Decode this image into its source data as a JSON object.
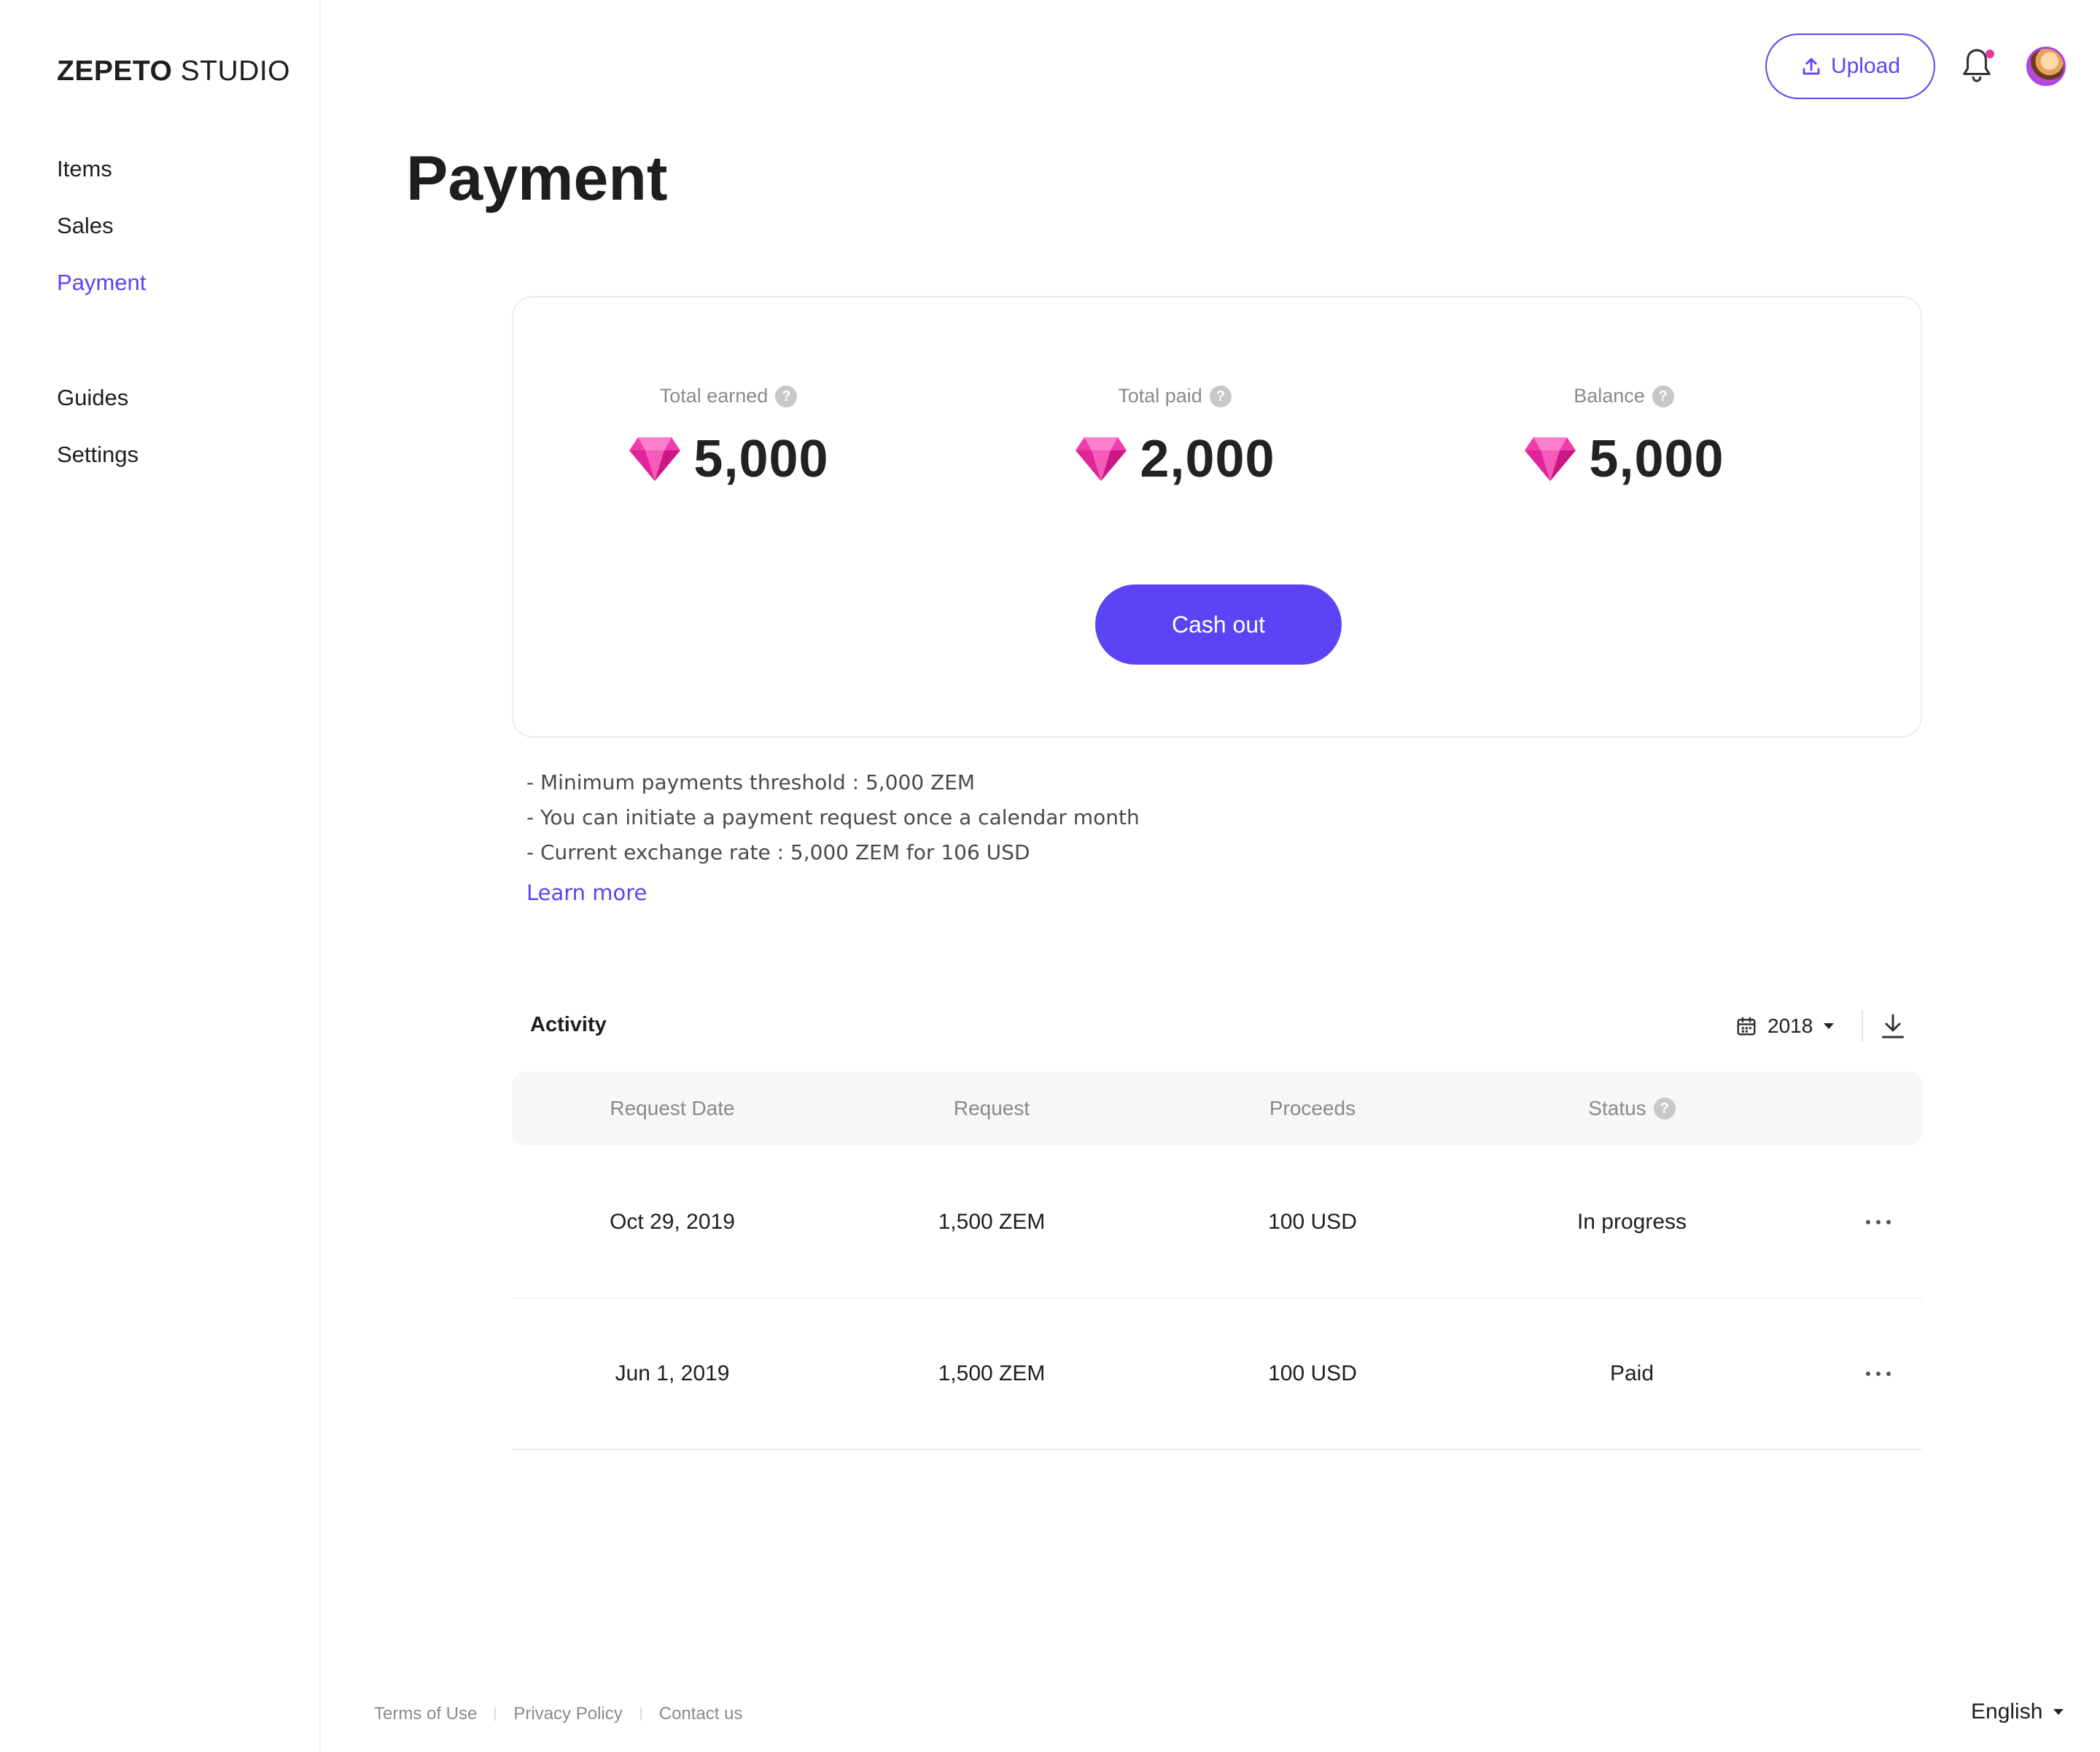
{
  "app": {
    "brand": "ZEPETO",
    "brand_suffix": " STUDIO"
  },
  "sidebar": {
    "items": [
      {
        "label": "Items"
      },
      {
        "label": "Sales"
      },
      {
        "label": "Payment",
        "active": true
      },
      {
        "label": "Guides"
      },
      {
        "label": "Settings"
      }
    ]
  },
  "header": {
    "upload_label": "Upload",
    "upload_icon": "upload-icon",
    "notification_icon": "bell-icon",
    "has_unread_notification": true,
    "avatar": "user-avatar"
  },
  "page": {
    "title": "Payment"
  },
  "summary": {
    "currency_icon": "gem-icon",
    "total_earned": {
      "label": "Total earned",
      "value": "5,000"
    },
    "total_paid": {
      "label": "Total paid",
      "value": "2,000"
    },
    "balance": {
      "label": "Balance",
      "value": "5,000"
    },
    "cashout_label": "Cash out"
  },
  "notes": {
    "lines": [
      "- Minimum payments threshold : 5,000 ZEM",
      "- You can initiate a payment request once a calendar month",
      "- Current exchange rate : 5,000 ZEM for 106 USD"
    ],
    "learn_more": "Learn more"
  },
  "activity": {
    "title": "Activity",
    "year": "2018",
    "columns": [
      "Request Date",
      "Request",
      "Proceeds",
      "Status"
    ],
    "rows": [
      {
        "date": "Oct 29, 2019",
        "request": "1,500 ZEM",
        "proceeds": "100 USD",
        "status": "In progress"
      },
      {
        "date": "Jun 1, 2019",
        "request": "1,500 ZEM",
        "proceeds": "100 USD",
        "status": "Paid"
      }
    ]
  },
  "footer": {
    "links": [
      "Terms of Use",
      "Privacy Policy",
      "Contact us"
    ],
    "language": "English"
  },
  "colors": {
    "accent": "#5b44f5",
    "gem": "#f03ca8",
    "notification_dot": "#e2389b"
  }
}
